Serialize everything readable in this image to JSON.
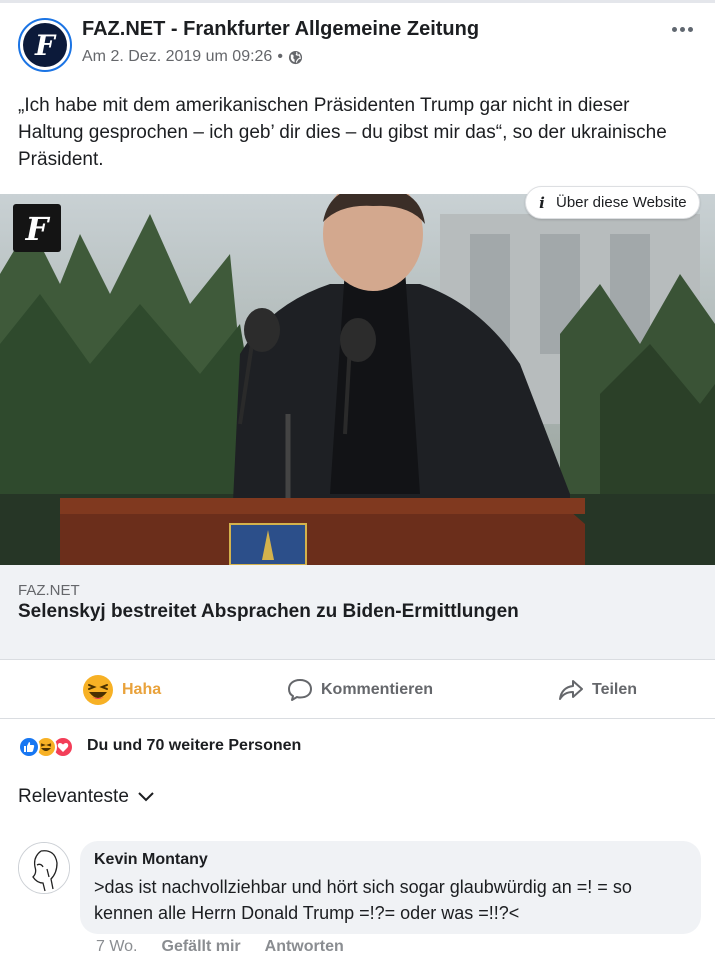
{
  "post": {
    "page_name": "FAZ.NET - Frankfurter Allgemeine Zeitung",
    "timestamp": "Am 2. Dez. 2019 um 09:26",
    "separator": "•",
    "privacy_icon": "globe-icon",
    "text": "„Ich habe mit dem amerikanischen Präsidenten Trump gar nicht in dieser Haltung gesprochen – ich geb’ dir dies – du gibst mir das“, so der ukrainische Präsident."
  },
  "preview": {
    "about_label": "Über diese Website",
    "info_glyph": "i",
    "domain": "FAZ.NET",
    "title": "Selenskyj bestreitet Absprachen zu Biden-Ermittlungen"
  },
  "actions": {
    "haha_label": "Haha",
    "comment_label": "Kommentieren",
    "share_label": "Teilen"
  },
  "reactions": {
    "summary": "Du und 70 weitere Personen",
    "types": [
      "like",
      "haha",
      "love"
    ]
  },
  "comments": {
    "sort_label": "Relevanteste",
    "items": [
      {
        "author": "Kevin Montany",
        "text": ">das ist nachvollziehbar und hört sich sogar glaubwürdig an =! = so kennen alle Herrn Donald Trump =!?= oder was =!!?<",
        "age": "7 Wo.",
        "like_label": "Gefällt mir",
        "reply_label": "Antworten"
      }
    ]
  },
  "colors": {
    "accent": "#1b74e4",
    "haha": "#e9a23b",
    "secondary_text": "#65676b",
    "bubble_bg": "#f0f2f5"
  }
}
